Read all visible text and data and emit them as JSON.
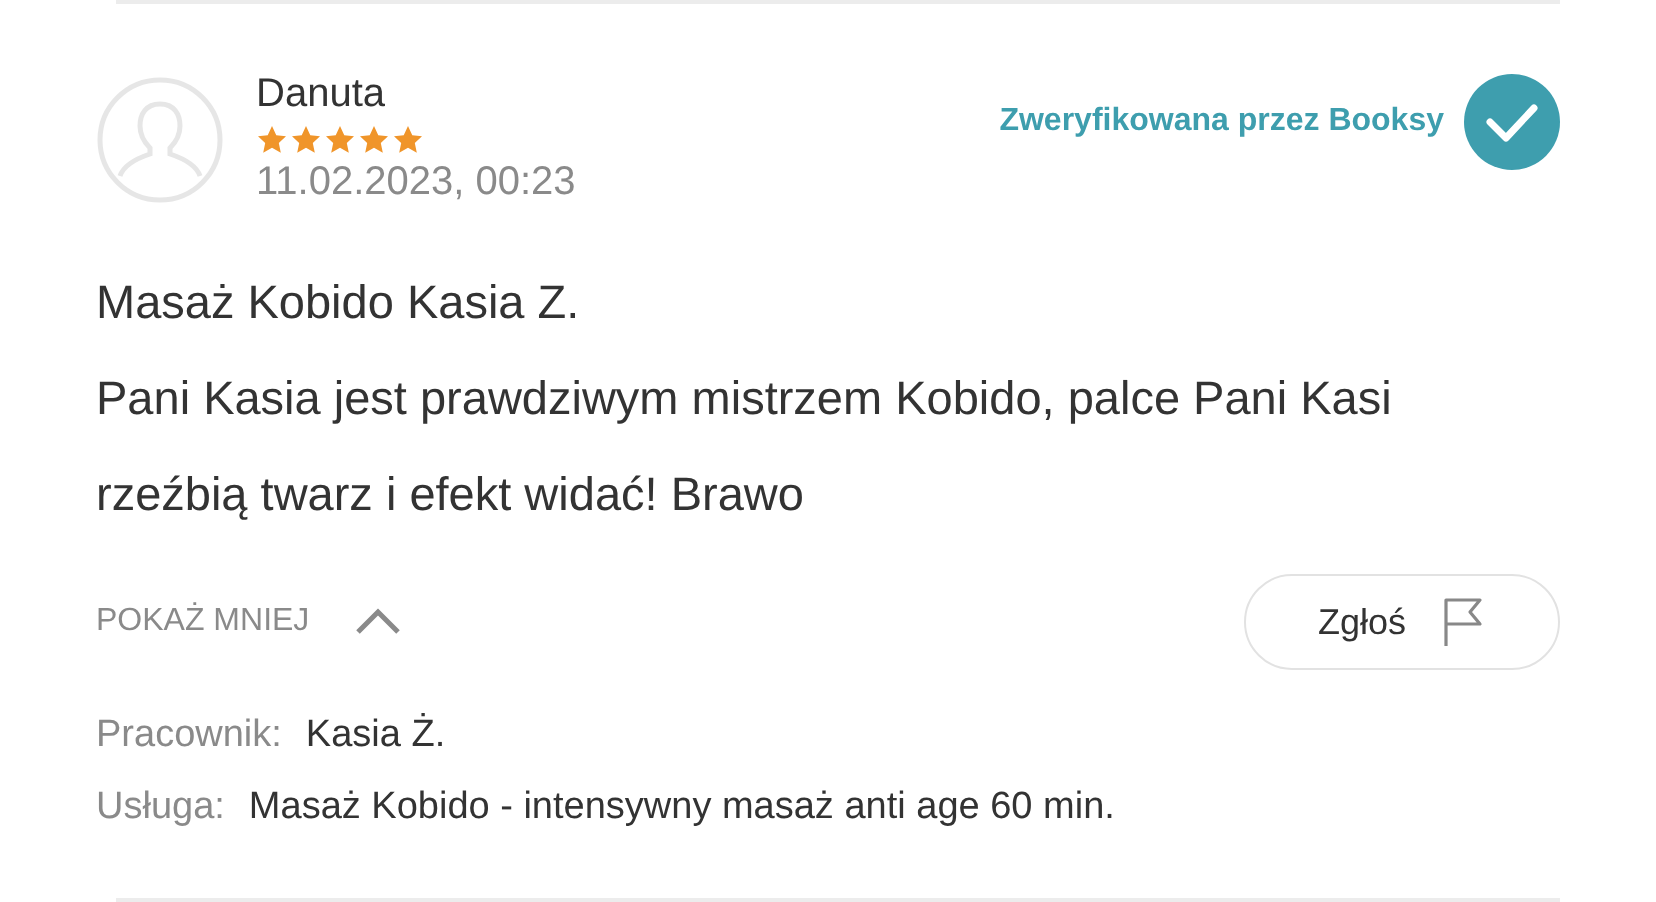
{
  "review": {
    "author": "Danuta",
    "stars": 5,
    "date": "11.02.2023, 00:23",
    "verified": true,
    "verified_label": "Zweryfikowana przez Booksy",
    "title": "Masaż Kobido Kasia Z.",
    "text": "Pani Kasia jest prawdziwym mistrzem Kobido, palce Pani Kasi rzeźbią twarz i efekt widać! Brawo",
    "show_less": "POKAŻ MNIEJ",
    "expanded": true,
    "report_button": "Zgłoś",
    "details": [
      {
        "label": "Pracownik:",
        "value": "Kasia Ż."
      },
      {
        "label": "Usługa:",
        "value": "Masaż Kobido - intensywny masaż anti age 60 min."
      }
    ]
  }
}
